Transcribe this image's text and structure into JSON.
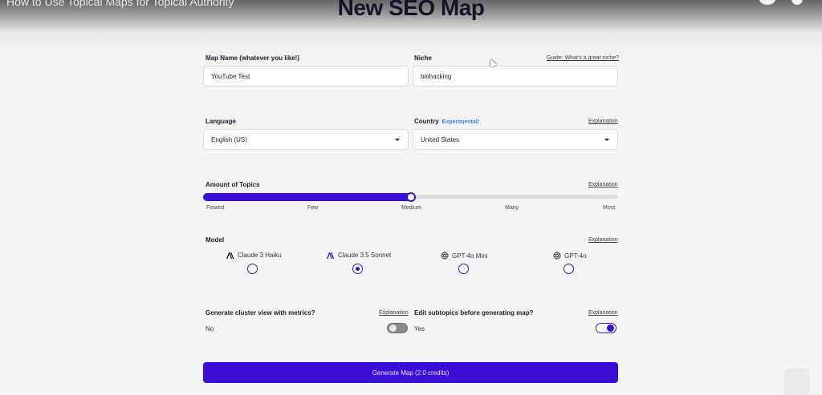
{
  "video_title": "How to Use Topical Maps for Topical Authority",
  "page_title": "New SEO Map",
  "map_name": {
    "label": "Map Name (whatever you like!)",
    "value": "YouTube Test"
  },
  "niche": {
    "label": "Niche",
    "guide_link": "Guide: What's a great niche?",
    "value": "biohacking"
  },
  "language": {
    "label": "Language",
    "value": "English (US)"
  },
  "country": {
    "label": "Country",
    "badge": "Experimental!",
    "explanation": "Explanation",
    "value": "United States"
  },
  "topics": {
    "label": "Amount of Topics",
    "explanation": "Explanation",
    "ticks": [
      "Fewest",
      "Few",
      "Medium",
      "Many",
      "Most"
    ],
    "selected": "Medium",
    "level": 0.5
  },
  "model": {
    "label": "Model",
    "explanation": "Explanation",
    "options": [
      {
        "name": "Claude 3 Haiku",
        "icon": "anthropic-icon",
        "selected": false
      },
      {
        "name": "Claude 3.5 Sonnet",
        "icon": "anthropic-icon",
        "selected": true
      },
      {
        "name": "GPT-4o Mini",
        "icon": "openai-icon",
        "selected": false
      },
      {
        "name": "GPT-4o",
        "icon": "openai-icon",
        "selected": false
      }
    ]
  },
  "cluster_view": {
    "label": "Generate cluster view with metrics?",
    "explanation": "Explanation",
    "value": "No",
    "enabled": false
  },
  "edit_subtopics": {
    "label": "Edit subtopics before generating map?",
    "explanation": "Explanation",
    "value": "Yes",
    "enabled": true
  },
  "generate_button": "Generate Map (2.0 credits)",
  "colors": {
    "accent": "#3a0ed6",
    "link_blue": "#3b82f6",
    "background": "#f5f5f5"
  }
}
